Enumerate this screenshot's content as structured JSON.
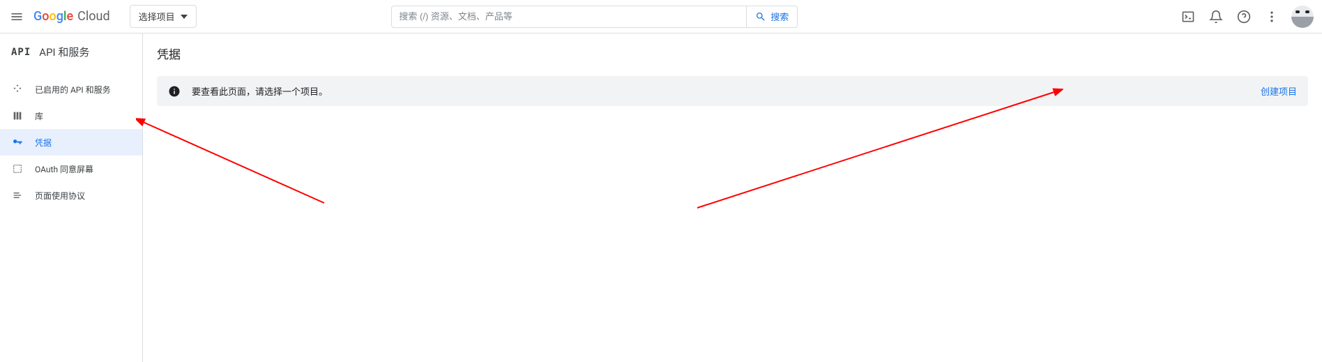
{
  "header": {
    "logo_text": "Google",
    "logo_suffix": "Cloud",
    "project_selector_label": "选择项目",
    "search_placeholder": "搜索 (/) 资源、文档、产品等",
    "search_button_label": "搜索"
  },
  "sidebar": {
    "section_title": "API 和服务",
    "api_badge": "API",
    "items": [
      {
        "label": "已启用的 API 和服务",
        "icon": "dashboard"
      },
      {
        "label": "库",
        "icon": "library"
      },
      {
        "label": "凭据",
        "icon": "key"
      },
      {
        "label": "OAuth 同意屏幕",
        "icon": "consent"
      },
      {
        "label": "页面使用协议",
        "icon": "agreement"
      }
    ]
  },
  "content": {
    "page_title": "凭据",
    "banner_message": "要查看此页面，请选择一个项目。",
    "banner_action": "创建项目"
  },
  "annotations": {
    "arrow_left": {
      "target": "credentials-sidebar-item"
    },
    "arrow_right": {
      "target": "create-project-link"
    }
  }
}
